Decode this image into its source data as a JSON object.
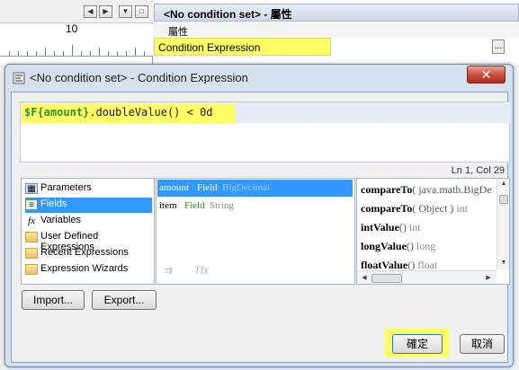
{
  "background": {
    "ruler_label": "10",
    "properties_title": "<No condition set> - 屬性",
    "group_label": "屬性",
    "selected_property": "Condition Expression"
  },
  "dialog": {
    "title": "<No condition set> - Condition Expression",
    "expression": {
      "field_token": "$F{amount}",
      "rest": ".doubleValue() < 0d"
    },
    "cursor_status": "Ln 1, Col 29",
    "categories": [
      {
        "label": "Parameters",
        "icon": "parameters-icon"
      },
      {
        "label": "Fields",
        "icon": "fields-icon",
        "selected": true
      },
      {
        "label": "Variables",
        "icon": "variables-icon"
      },
      {
        "label": "User Defined Expressions",
        "icon": "folder-icon"
      },
      {
        "label": "Recent Expressions",
        "icon": "folder-icon"
      },
      {
        "label": "Expression Wizards",
        "icon": "folder-icon"
      }
    ],
    "fields": [
      {
        "name": "amount",
        "kind": "Field",
        "type": "BigDecimal",
        "selected": true
      },
      {
        "name": "item",
        "kind": "Field",
        "type": "String"
      }
    ],
    "methods": [
      {
        "name": "compareTo",
        "args": "( java.math.BigDe",
        "ret": ""
      },
      {
        "name": "compareTo",
        "args": "( Object )",
        "ret": "int"
      },
      {
        "name": "intValue",
        "args": "()",
        "ret": "int"
      },
      {
        "name": "longValue",
        "args": "()",
        "ret": "long"
      },
      {
        "name": "floatValue",
        "args": "()",
        "ret": "float"
      }
    ],
    "buttons": {
      "import": "Import...",
      "export": "Export...",
      "ok": "確定",
      "cancel": "取消"
    },
    "colors": {
      "highlight": "#ffff66",
      "selection": "#3399ff",
      "field_token": "#2f8f2f"
    }
  }
}
